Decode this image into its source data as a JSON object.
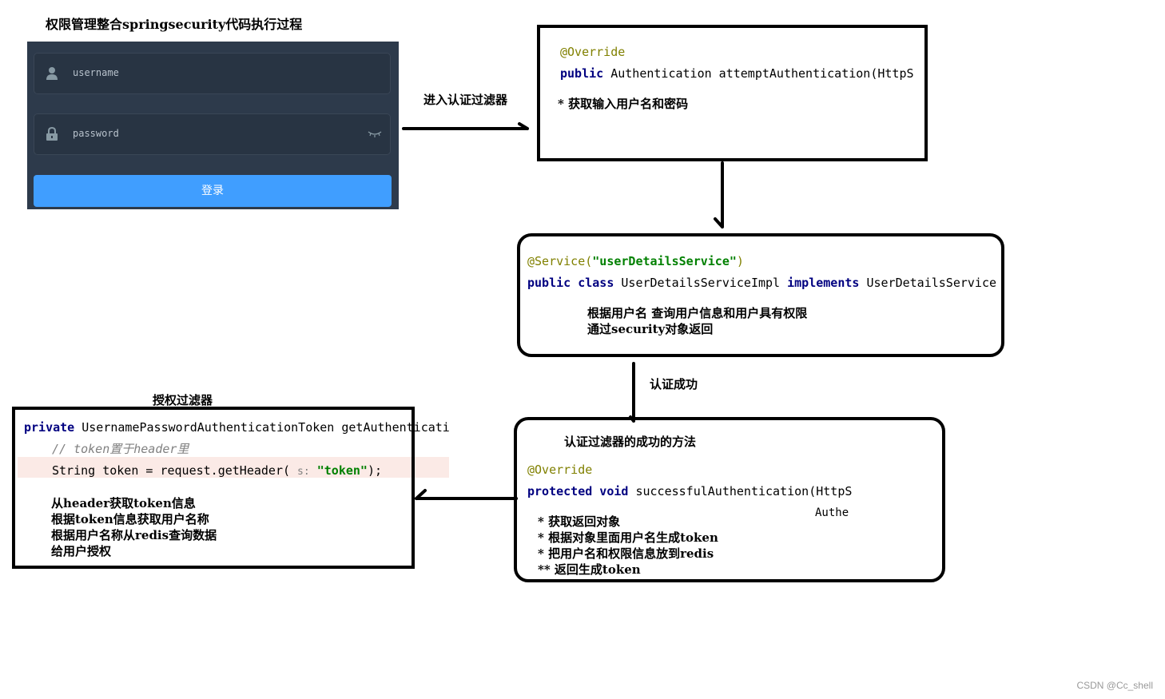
{
  "title": "权限管理整合springsecurity代码执行过程",
  "login": {
    "username_placeholder": "username",
    "password_placeholder": "password",
    "login_button": "登录",
    "colors": {
      "panel": "#2d3a4b",
      "field": "#283443",
      "button": "#409eff"
    }
  },
  "arrows": {
    "login_to_auth_filter": "进入认证过滤器",
    "service_to_success": "认证成功"
  },
  "box1": {
    "annotation": "@Override",
    "code_kw": "public",
    "code_rest": " Authentication attemptAuthentication(HttpS",
    "note": "* 获取输入用户名和密码"
  },
  "box2": {
    "annotation_prefix": "@Service(",
    "annotation_string": "\"userDetailsService\"",
    "annotation_suffix": ")",
    "kw1": "public class",
    "class_name": " UserDetailsServiceImpl ",
    "kw2": "implements",
    "interface_name": " UserDetailsService",
    "notes": [
      "根据用户名 查询用户信息和用户具有权限",
      "通过security对象返回"
    ]
  },
  "box3": {
    "heading": "认证过滤器的成功的方法",
    "annotation": "@Override",
    "kw": "protected void",
    "code_rest": " successfulAuthentication(HttpS",
    "overflow_text": "Authe",
    "notes": [
      "* 获取返回对象",
      "* 根据对象里面用户名生成token",
      "* 把用户名和权限信息放到redis",
      "** 返回生成token"
    ]
  },
  "box4": {
    "heading": "授权过滤器",
    "kw": "private",
    "code_rest": " UsernamePasswordAuthenticationToken getAuthenticati",
    "comment": "// token置于header里",
    "line3_pre": "String token = request.getHeader( ",
    "line3_hint": "s:",
    "line3_str": " \"token\"",
    "line3_post": ");",
    "notes": [
      "从header获取token信息",
      "根据token信息获取用户名称",
      "根据用户名称从redis查询数据",
      "给用户授权"
    ]
  },
  "watermark": "CSDN @Cc_shell"
}
